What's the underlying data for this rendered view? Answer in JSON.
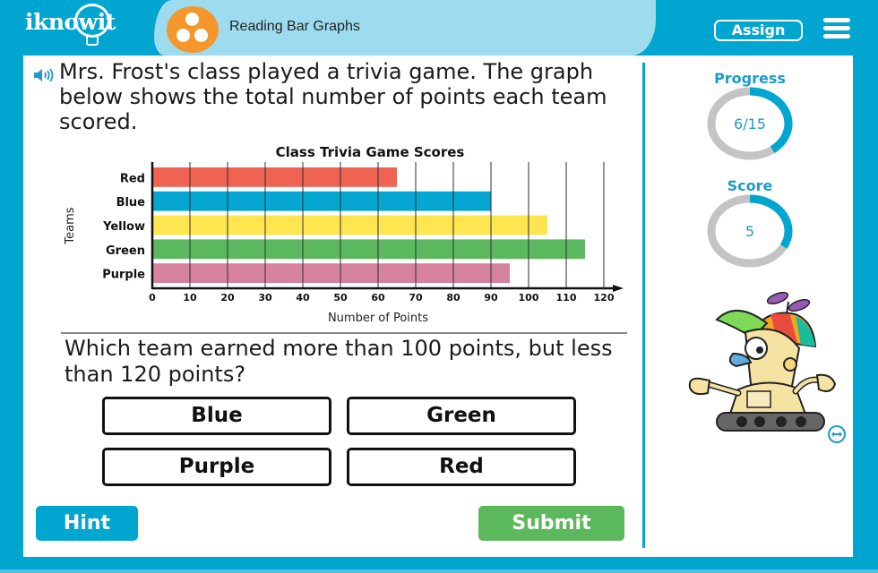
{
  "app": {
    "logo": "iknowit",
    "lesson_title": "Reading Bar Graphs",
    "assign_label": "Assign",
    "menu_icon": "hamburger-menu-icon",
    "lesson_icon": "three-dots-circle-icon"
  },
  "colors": {
    "brand_blue": "#00a6cf",
    "pill_light_blue": "#9ddcee",
    "lesson_icon_orange": "#f5972c",
    "submit_green": "#5cb85c",
    "ring_gray": "#c4c4c4",
    "stat_text_blue": "#1f9ac9"
  },
  "question": {
    "speaker_icon": "speaker-icon",
    "prompt": "Mrs. Frost's class played a trivia game. The graph below shows the total number of points each team scored.",
    "text": "Which team earned more than 100 points, but less than 120 points?",
    "answers": [
      "Blue",
      "Green",
      "Purple",
      "Red"
    ]
  },
  "actions": {
    "hint_label": "Hint",
    "submit_label": "Submit"
  },
  "sidebar": {
    "progress_label": "Progress",
    "progress_value": "6/15",
    "progress_fraction": 0.4,
    "score_label": "Score",
    "score_value": "5",
    "score_fraction": 0.33,
    "mascot": "robot-mascot-with-propeller-cap",
    "expand_icon": "expand-arrows-icon"
  },
  "chart_data": {
    "type": "bar",
    "orientation": "horizontal",
    "title": "Class Trivia Game Scores",
    "xlabel": "Number of Points",
    "ylabel": "Teams",
    "categories": [
      "Red",
      "Blue",
      "Yellow",
      "Green",
      "Purple"
    ],
    "values": [
      65,
      90,
      105,
      115,
      95
    ],
    "bar_colors": [
      "#ee6352",
      "#05a6d1",
      "#ffe54f",
      "#5cb85f",
      "#d6829f"
    ],
    "xlim": [
      0,
      120
    ],
    "xticks": [
      0,
      10,
      20,
      30,
      40,
      50,
      60,
      70,
      80,
      90,
      100,
      110,
      120
    ],
    "grid": true
  }
}
